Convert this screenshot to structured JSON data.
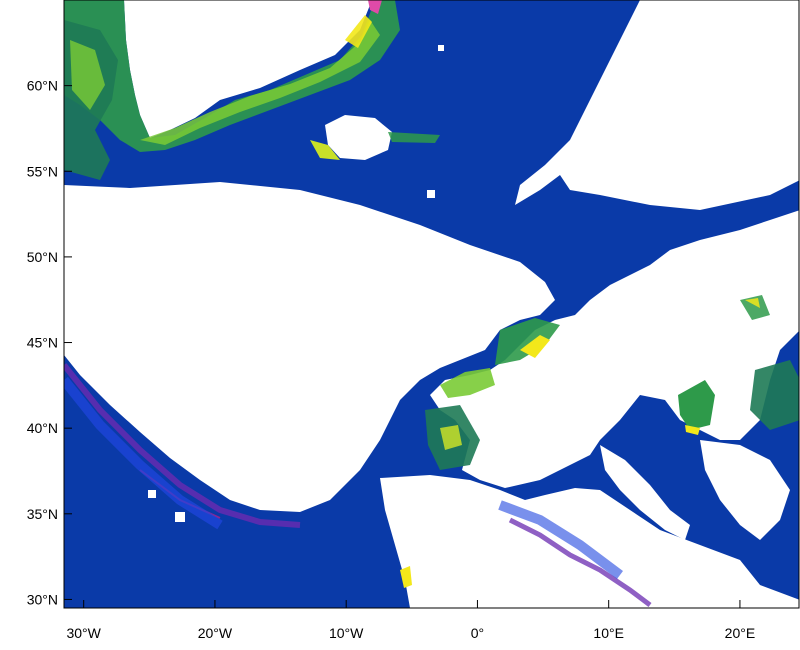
{
  "map": {
    "colors": {
      "ocean": "#0a3aa8",
      "land_and_masked": "#ffffff",
      "frame": "#000000",
      "low": "#1f46e0",
      "mid_blue": "#2a2ad8",
      "violet": "#6a2bb0",
      "magenta": "#b0208a",
      "teal": "#1e7a55",
      "green": "#2e9a4a",
      "light_green": "#7acb35",
      "yellow_green": "#c8e028",
      "yellow": "#f3e81a",
      "pink": "#e04aa8"
    },
    "x_axis": {
      "ticks": [
        {
          "label": "30°W",
          "lon": -30
        },
        {
          "label": "20°W",
          "lon": -20
        },
        {
          "label": "10°W",
          "lon": -10
        },
        {
          "label": "0°",
          "lon": 0
        },
        {
          "label": "10°E",
          "lon": 10
        },
        {
          "label": "20°E",
          "lon": 20
        }
      ]
    },
    "y_axis": {
      "ticks": [
        {
          "label": "60°N",
          "lat": 60
        },
        {
          "label": "55°N",
          "lat": 55
        },
        {
          "label": "50°N",
          "lat": 50
        },
        {
          "label": "45°N",
          "lat": 45
        },
        {
          "label": "40°N",
          "lat": 40
        },
        {
          "label": "35°N",
          "lat": 35
        },
        {
          "label": "30°N",
          "lat": 30
        }
      ]
    },
    "extent": {
      "lon_min": -31.5,
      "lon_max": 24.5,
      "lat_min": 29.5,
      "lat_max": 65.0
    }
  }
}
